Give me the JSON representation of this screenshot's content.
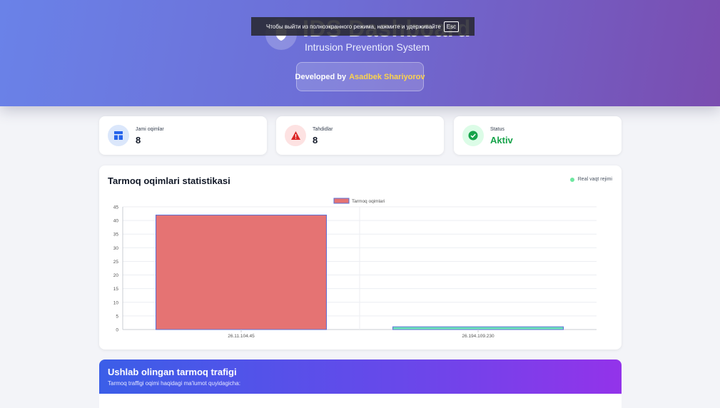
{
  "header": {
    "title": "IDS Dashboard",
    "subtitle": "Intrusion Prevention System",
    "developed_by_label": "Developed by",
    "developer_name": "Asadbek Shariyorov"
  },
  "fullscreen_notice": {
    "text": "Чтобы выйти из полноэкранного режима, нажмите и удерживайте",
    "key": "Esc"
  },
  "stats": [
    {
      "label": "Jami oqimlar",
      "value": "8",
      "icon": "dashboard-icon",
      "color": "#2563eb"
    },
    {
      "label": "Tahdidlar",
      "value": "8",
      "icon": "warning-icon",
      "color": "#dc2626"
    },
    {
      "label": "Status",
      "value": "Aktiv",
      "icon": "check-circle-icon",
      "color": "#16a34a"
    }
  ],
  "chart_panel": {
    "title": "Tarmoq oqimlari statistikasi",
    "live_label": "Real vaqt rejimi"
  },
  "chart_data": {
    "type": "bar",
    "categories": [
      "26.11.104.45",
      "26.194.109.230"
    ],
    "series": [
      {
        "name": "Tarmoq oqimlari",
        "values": [
          42,
          1
        ],
        "colors": [
          "#e57373",
          "#6ee7b7"
        ]
      }
    ],
    "ylim": [
      0,
      45
    ],
    "yticks": [
      0,
      5,
      10,
      15,
      20,
      25,
      30,
      35,
      40,
      45
    ],
    "legend_position": "top-center",
    "grid": true
  },
  "traffic_panel": {
    "title": "Ushlab olingan tarmoq trafigi",
    "subtitle": "Tarmoq traffigi oqimi haqidagi ma'lumot quyidagicha:"
  }
}
